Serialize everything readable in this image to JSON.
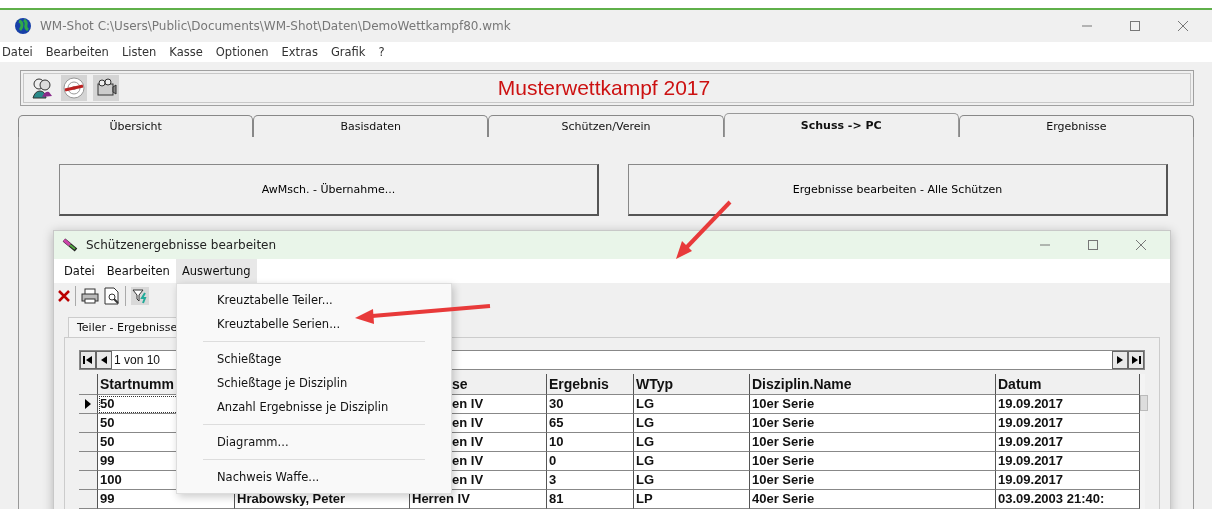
{
  "window": {
    "title": "WM-Shot C:\\Users\\Public\\Documents\\WM-Shot\\Daten\\DemoWettkampf80.wmk"
  },
  "menu": [
    "Datei",
    "Bearbeiten",
    "Listen",
    "Kasse",
    "Optionen",
    "Extras",
    "Grafik",
    "?"
  ],
  "banner": {
    "title": "Musterwettkampf 2017"
  },
  "tabs": [
    {
      "label": "Übersicht",
      "selected": false
    },
    {
      "label": "Basisdaten",
      "selected": false
    },
    {
      "label": "Schützen/Verein",
      "selected": false
    },
    {
      "label": "Schuss -> PC",
      "selected": true
    },
    {
      "label": "Ergebnisse",
      "selected": false
    }
  ],
  "actions": [
    "AwMsch. - Übernahme...",
    "Ergebnisse bearbeiten - Alle Schützen"
  ],
  "dialog": {
    "title": "Schützenergebnisse bearbeiten",
    "menu": [
      {
        "label": "Datei",
        "expanded": false
      },
      {
        "label": "Bearbeiten",
        "expanded": false
      },
      {
        "label": "Auswertung",
        "expanded": true
      }
    ],
    "dropdown": [
      [
        "Kreuztabelle Teiler...",
        "Kreuztabelle Serien..."
      ],
      [
        "Schießtage",
        "Schießtage je Disziplin",
        "Anzahl Ergebnisse je Disziplin"
      ],
      [
        "Diagramm..."
      ],
      [
        "Nachweis Waffe..."
      ]
    ],
    "tab": "Teiler - Ergebnisse",
    "navigator": "1 von 10",
    "columns": [
      "Startnumm",
      null,
      "se",
      "Ergebnis",
      "WTyp",
      "Disziplin.Name",
      "Datum"
    ],
    "rows": [
      {
        "current": true,
        "cells": [
          "50",
          null,
          "en IV",
          "30",
          "LG",
          "10er Serie",
          "19.09.2017"
        ]
      },
      {
        "current": false,
        "cells": [
          "50",
          null,
          "en IV",
          "65",
          "LG",
          "10er Serie",
          "19.09.2017"
        ]
      },
      {
        "current": false,
        "cells": [
          "50",
          null,
          "en IV",
          "10",
          "LG",
          "10er Serie",
          "19.09.2017"
        ]
      },
      {
        "current": false,
        "cells": [
          "99",
          null,
          "en IV",
          "0",
          "LG",
          "10er Serie",
          "19.09.2017"
        ]
      },
      {
        "current": false,
        "cells": [
          "100",
          null,
          "en IV",
          "3",
          "LG",
          "10er Serie",
          "19.09.2017"
        ]
      },
      {
        "current": false,
        "cells": [
          "99",
          "Hrabowsky, Peter",
          "Herren IV",
          "81",
          "LP",
          "40er Serie",
          "03.09.2003 21:40:"
        ]
      }
    ]
  }
}
